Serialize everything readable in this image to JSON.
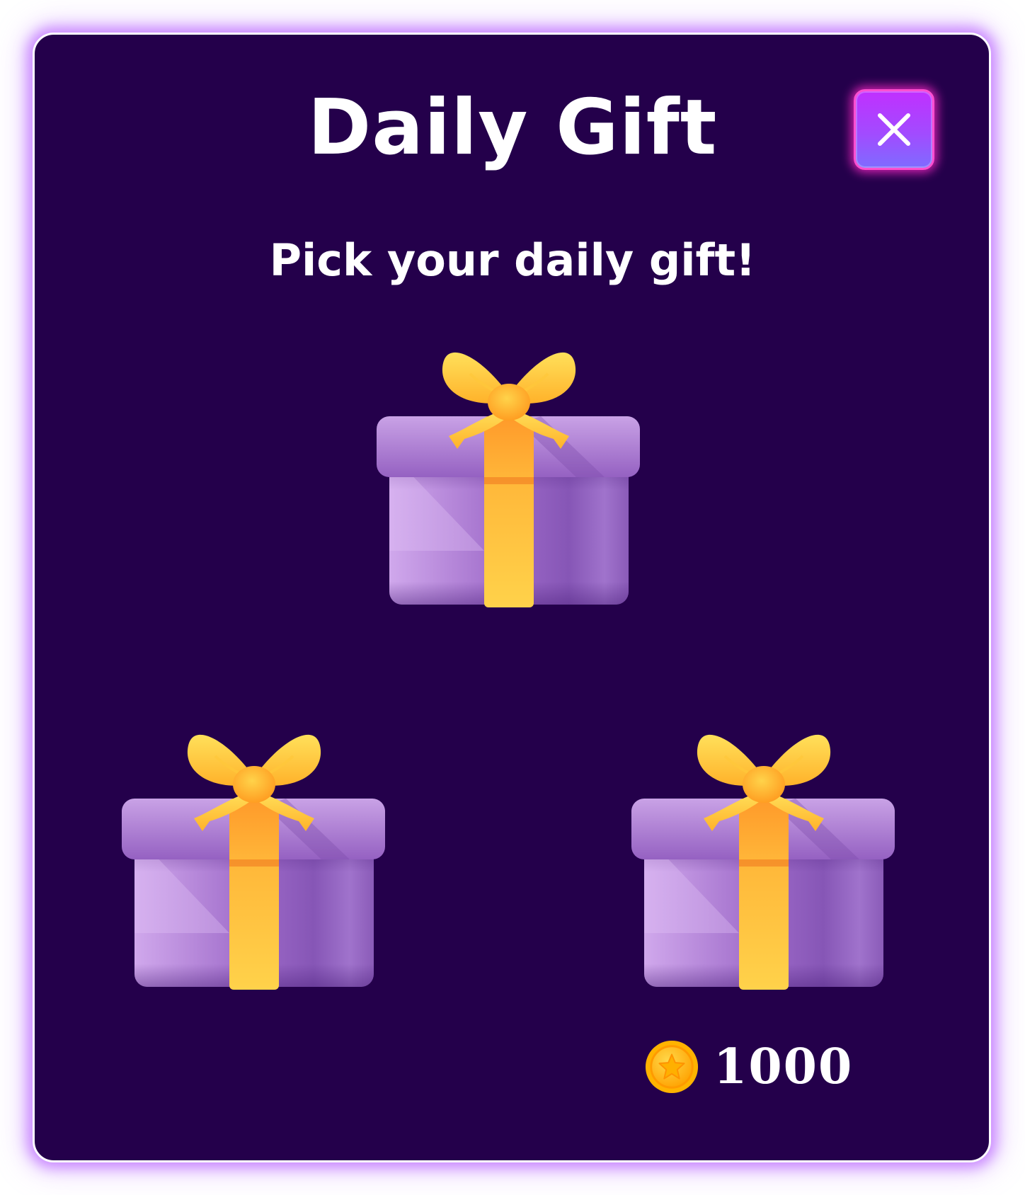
{
  "dialog": {
    "title": "Daily Gift",
    "subtitle": "Pick your daily gift!",
    "close_icon": "close-icon"
  },
  "gifts": [
    {
      "id": "top",
      "icon": "gift-box-icon"
    },
    {
      "id": "left",
      "icon": "gift-box-icon"
    },
    {
      "id": "right",
      "icon": "gift-box-icon"
    }
  ],
  "reward": {
    "icon": "coin-star-icon",
    "amount": "1000"
  },
  "colors": {
    "panel_background": "#24004b",
    "panel_glow": "#be6eff",
    "close_button": "#a24bff",
    "gift_box": "#9b6bc6",
    "ribbon": "#ffc42e",
    "coin": "#ffb000"
  }
}
